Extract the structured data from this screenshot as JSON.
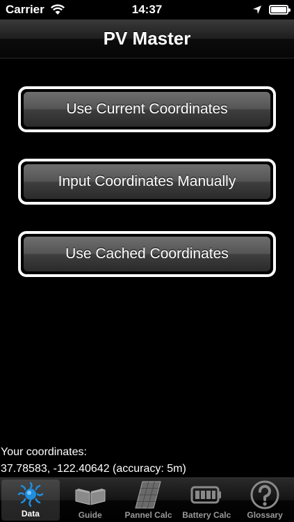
{
  "status": {
    "carrier": "Carrier",
    "time": "14:37"
  },
  "nav": {
    "title": "PV Master"
  },
  "buttons": {
    "current": "Use Current Coordinates",
    "manual": "Input Coordinates Manually",
    "cached": "Use Cached Coordinates"
  },
  "coords": {
    "label": "Your coordinates:",
    "value": "37.78583, -122.40642 (accuracy: 5m)"
  },
  "tabs": [
    {
      "label": "Data",
      "icon": "sun-icon",
      "active": true
    },
    {
      "label": "Guide",
      "icon": "book-icon",
      "active": false
    },
    {
      "label": "Pannel Calc",
      "icon": "solar-panel-icon",
      "active": false
    },
    {
      "label": "Battery Calc",
      "icon": "battery-icon",
      "active": false
    },
    {
      "label": "Glossary",
      "icon": "question-icon",
      "active": false
    }
  ],
  "colors": {
    "sun_blue": "#1e8fe0",
    "tab_inactive": "#9a9a9a"
  }
}
